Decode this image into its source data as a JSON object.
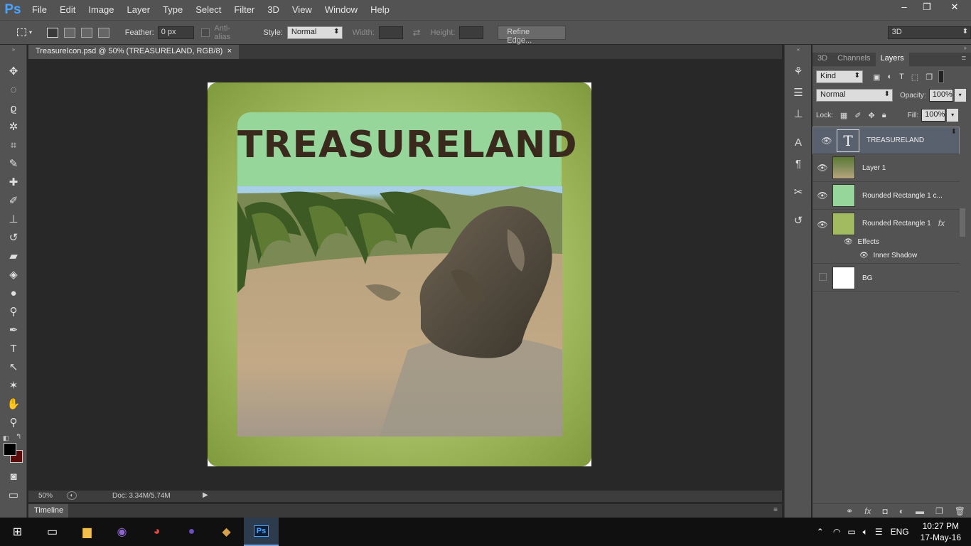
{
  "app": {
    "logo": "Ps"
  },
  "menu": [
    "File",
    "Edit",
    "Image",
    "Layer",
    "Type",
    "Select",
    "Filter",
    "3D",
    "View",
    "Window",
    "Help"
  ],
  "window_controls": {
    "minimize": "–",
    "restore": "❐",
    "close": "✕"
  },
  "options": {
    "feather_label": "Feather:",
    "feather_value": "0 px",
    "antialias_label": "Anti-alias",
    "style_label": "Style:",
    "style_value": "Normal",
    "width_label": "Width:",
    "height_label": "Height:",
    "refine_edge": "Refine Edge...",
    "workspace": "3D"
  },
  "document": {
    "tab_title": "TreasureIcon.psd @ 50% (TREASURELAND, RGB/8)",
    "tab_close": "×",
    "zoom": "50%",
    "doc_size": "Doc: 3.34M/5.74M",
    "timeline": "Timeline"
  },
  "artwork": {
    "title": "TREASURELAND",
    "frame_color": "#a3bb60",
    "banner_color": "#96d69a",
    "title_color": "#3a2a1e"
  },
  "panel": {
    "tabs": [
      "3D",
      "Channels",
      "Layers"
    ],
    "active_tab": "Layers",
    "filter": "Kind",
    "blend_mode": "Normal",
    "opacity_label": "Opacity:",
    "opacity_value": "100%",
    "lock_label": "Lock:",
    "fill_label": "Fill:",
    "fill_value": "100%",
    "layers": [
      {
        "name": "TREASURELAND",
        "kind": "text",
        "visible": true,
        "selected": true
      },
      {
        "name": "Layer 1",
        "kind": "image",
        "visible": true
      },
      {
        "name": "Rounded Rectangle 1 c...",
        "kind": "shape",
        "visible": true,
        "color": "#96d69a"
      },
      {
        "name": "Rounded Rectangle 1",
        "kind": "shape",
        "visible": true,
        "color": "#a3bb60",
        "fx": "fx"
      },
      {
        "name": "BG",
        "kind": "fill",
        "visible": false,
        "color": "#ffffff"
      }
    ],
    "effects_label": "Effects",
    "inner_shadow_label": "Inner Shadow"
  },
  "taskbar": {
    "language": "ENG",
    "time": "10:27 PM",
    "date": "17-May-16"
  }
}
